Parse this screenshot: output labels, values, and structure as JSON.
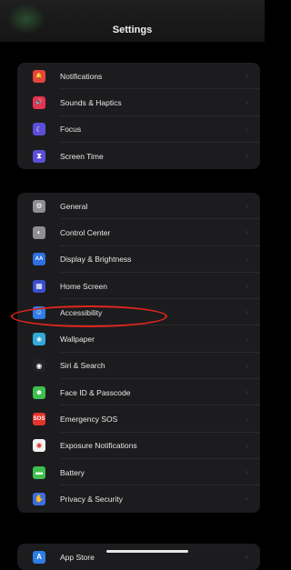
{
  "header": {
    "title": "Settings"
  },
  "groups": [
    [
      {
        "label": "Notifications",
        "icon": "bell-icon",
        "color": "#e5443c",
        "glyph": "🔔"
      },
      {
        "label": "Sounds & Haptics",
        "icon": "speaker-icon",
        "color": "#e4334f",
        "glyph": "🔊"
      },
      {
        "label": "Focus",
        "icon": "moon-icon",
        "color": "#5a4fd6",
        "glyph": "☾"
      },
      {
        "label": "Screen Time",
        "icon": "hourglass-icon",
        "color": "#5a4fd6",
        "glyph": "⧗"
      }
    ],
    [
      {
        "label": "General",
        "icon": "gear-icon",
        "color": "#8e8e93",
        "glyph": "⚙"
      },
      {
        "label": "Control Center",
        "icon": "toggles-icon",
        "color": "#8e8e93",
        "glyph": "◐"
      },
      {
        "label": "Display & Brightness",
        "icon": "aa-icon",
        "color": "#2f6fe0",
        "glyph": "AA"
      },
      {
        "label": "Home Screen",
        "icon": "grid-icon",
        "color": "#3a4fd0",
        "glyph": "▦"
      },
      {
        "label": "Accessibility",
        "icon": "accessibility-icon",
        "color": "#2f7de6",
        "glyph": "☺"
      },
      {
        "label": "Wallpaper",
        "icon": "flower-icon",
        "color": "#33a8d9",
        "glyph": "❀"
      },
      {
        "label": "Siri & Search",
        "icon": "siri-icon",
        "color": "#222226",
        "glyph": "◉"
      },
      {
        "label": "Face ID & Passcode",
        "icon": "face-id-icon",
        "color": "#3fbf4f",
        "glyph": "☻"
      },
      {
        "label": "Emergency SOS",
        "icon": "sos-icon",
        "color": "#e5332a",
        "glyph": "SOS"
      },
      {
        "label": "Exposure Notifications",
        "icon": "exposure-icon",
        "color": "#f2f2f2",
        "glyph": "✺"
      },
      {
        "label": "Battery",
        "icon": "battery-icon",
        "color": "#3fbf4f",
        "glyph": "▬"
      },
      {
        "label": "Privacy & Security",
        "icon": "hand-icon",
        "color": "#3b6ee0",
        "glyph": "✋"
      }
    ],
    [
      {
        "label": "App Store",
        "icon": "app-store-icon",
        "color": "#2f7de6",
        "glyph": "A"
      }
    ]
  ],
  "chevron": "›",
  "highlight_color": "#e0261e"
}
